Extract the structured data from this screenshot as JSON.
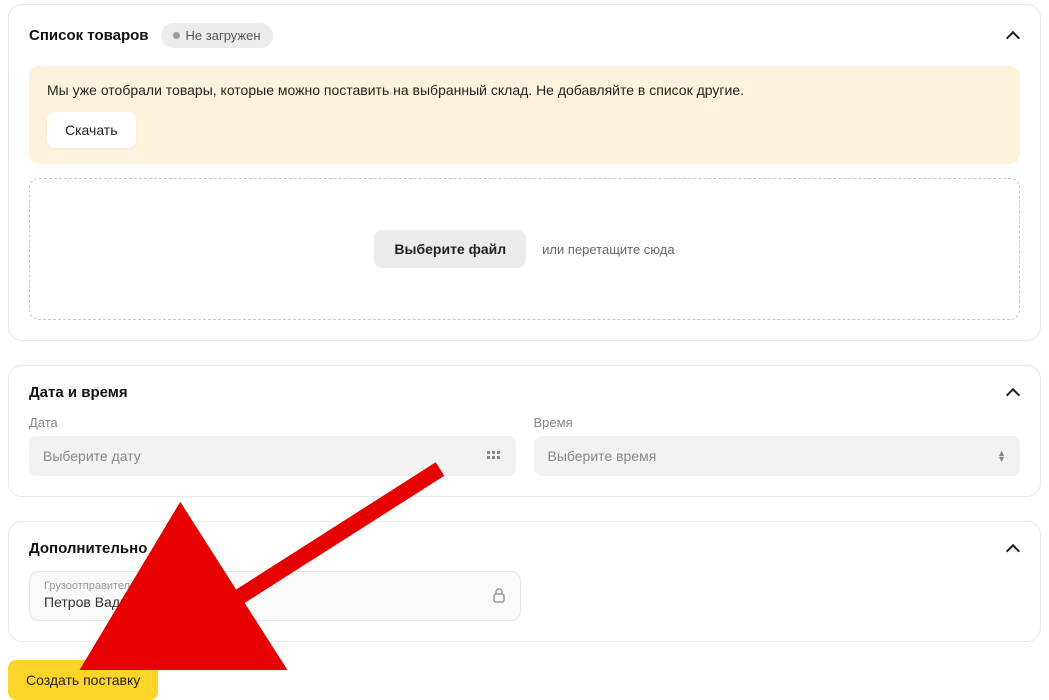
{
  "goods": {
    "title": "Список товаров",
    "badge_text": "Не загружен",
    "notice": "Мы уже отобрали товары, которые можно поставить на выбранный склад. Не добавляйте в список другие.",
    "download_label": "Скачать",
    "choose_file_label": "Выберите файл",
    "drag_hint": "или перетащите сюда"
  },
  "datetime": {
    "title": "Дата и время",
    "date_label": "Дата",
    "time_label": "Время",
    "date_placeholder": "Выберите дату",
    "time_placeholder": "Выберите время"
  },
  "additional": {
    "title": "Дополнительно",
    "shipper_label": "Грузоотправитель",
    "shipper_value": "Петров Вадим Вячеславович"
  },
  "submit_label": "Создать поставку"
}
